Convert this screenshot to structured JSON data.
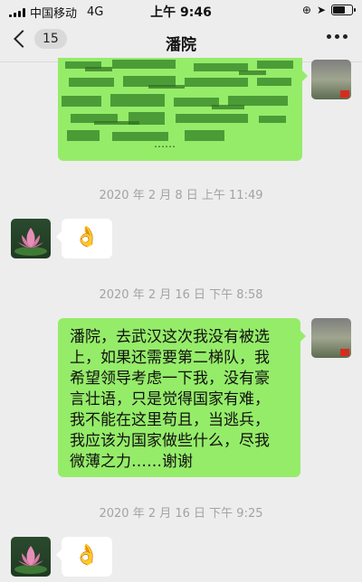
{
  "status_bar": {
    "carrier": "中国移动",
    "network": "4G",
    "time": "上午 9:46"
  },
  "nav": {
    "back_count": "15",
    "title": "潘院"
  },
  "messages": {
    "redacted_ellipsis": "……",
    "timestamp1": "2020 年 2 月 8 日 上午 11:49",
    "ok_emoji_1": "👌",
    "timestamp2": "2020 年 2 月 16 日 下午 8:58",
    "long_message_lines": [
      "潘院，去武汉这次我没有被选",
      "上，如果还需要第二梯队，我",
      "希望领导考虑一下我，没有豪",
      "言壮语，只是觉得国家有难，",
      "我不能在这里苟且，当逃兵，",
      "我应该为国家做些什么，尽我",
      "微薄之力……谢谢"
    ],
    "timestamp3": "2020 年 2 月 16 日 下午 9:25",
    "ok_emoji_2": "👌"
  },
  "colors": {
    "outgoing_bubble": "#95ec69",
    "incoming_bubble": "#ffffff",
    "background": "#ededed",
    "scribble": "#3f8f2f"
  }
}
